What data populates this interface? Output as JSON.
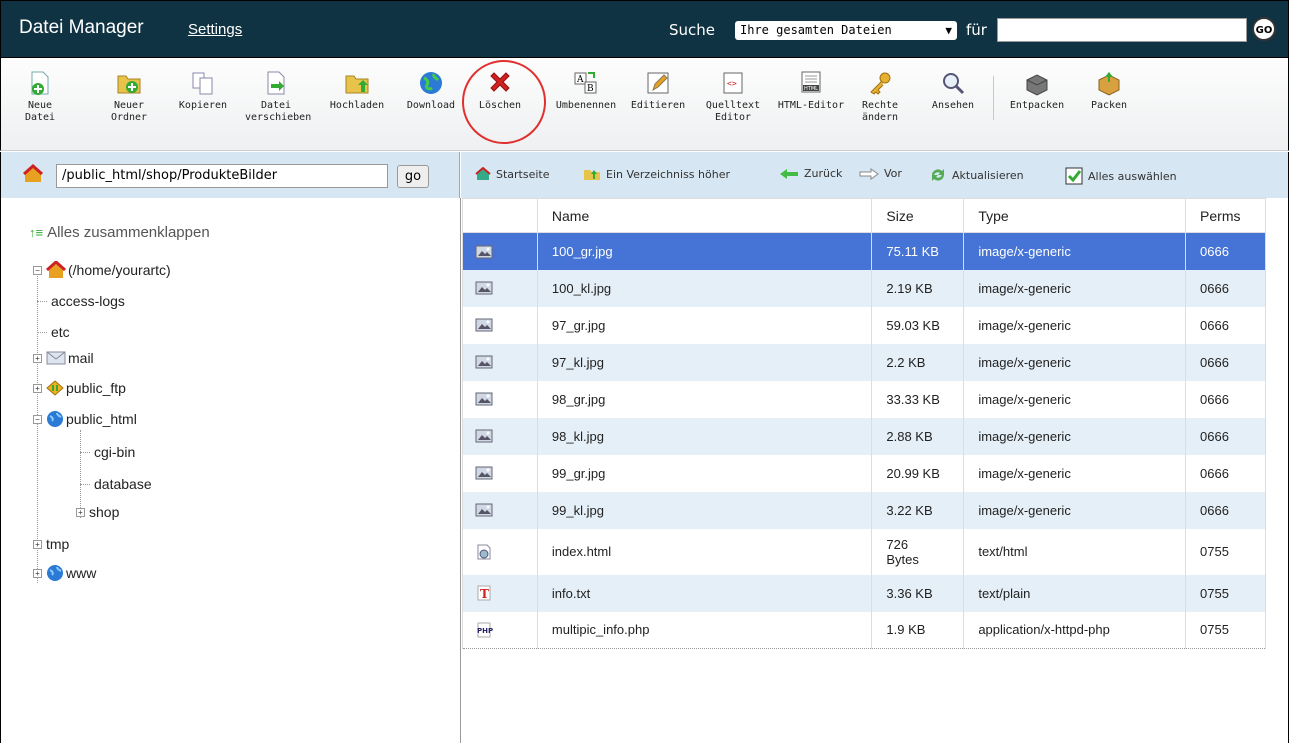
{
  "header": {
    "title": "Datei Manager",
    "settings_link": "Settings",
    "search_label": "Suche",
    "search_scope": "Ihre gesamten Dateien",
    "for_label": "für",
    "go_label": "GO"
  },
  "toolbar": {
    "new_file": "Neue Datei",
    "new_folder": "Neuer Ordner",
    "copy": "Kopieren",
    "move": "Datei verschieben",
    "upload": "Hochladen",
    "download": "Download",
    "delete": "Löschen",
    "rename": "Umbenennen",
    "edit": "Editieren",
    "source_editor": "Quelltext Editor",
    "html_editor": "HTML-Editor",
    "permissions": "Rechte ändern",
    "view": "Ansehen",
    "extract": "Entpacken",
    "compress": "Packen"
  },
  "pathbar": {
    "path": "/public_html/shop/ProdukteBilder",
    "go": "go"
  },
  "nav": {
    "home": "Startseite",
    "up": "Ein Verzeichniss höher",
    "back": "Zurück",
    "forward": "Vor",
    "refresh": "Aktualisieren",
    "select_all": "Alles auswählen"
  },
  "tree": {
    "collapse_all": "Alles zusammenklappen",
    "root": "(/home/yourartc)",
    "items": [
      "access-logs",
      "etc",
      "mail",
      "public_ftp",
      "public_html",
      "cgi-bin",
      "database",
      "shop",
      "tmp",
      "www"
    ]
  },
  "files": {
    "columns": [
      "Name",
      "Size",
      "Type",
      "Perms"
    ],
    "rows": [
      {
        "name": "100_gr.jpg",
        "size": "75.11 KB",
        "type": "image/x-generic",
        "perms": "0666",
        "icon": "image-icon"
      },
      {
        "name": "100_kl.jpg",
        "size": "2.19 KB",
        "type": "image/x-generic",
        "perms": "0666",
        "icon": "image-icon"
      },
      {
        "name": "97_gr.jpg",
        "size": "59.03 KB",
        "type": "image/x-generic",
        "perms": "0666",
        "icon": "image-icon"
      },
      {
        "name": "97_kl.jpg",
        "size": "2.2 KB",
        "type": "image/x-generic",
        "perms": "0666",
        "icon": "image-icon"
      },
      {
        "name": "98_gr.jpg",
        "size": "33.33 KB",
        "type": "image/x-generic",
        "perms": "0666",
        "icon": "image-icon"
      },
      {
        "name": "98_kl.jpg",
        "size": "2.88 KB",
        "type": "image/x-generic",
        "perms": "0666",
        "icon": "image-icon"
      },
      {
        "name": "99_gr.jpg",
        "size": "20.99 KB",
        "type": "image/x-generic",
        "perms": "0666",
        "icon": "image-icon"
      },
      {
        "name": "99_kl.jpg",
        "size": "3.22 KB",
        "type": "image/x-generic",
        "perms": "0666",
        "icon": "image-icon"
      },
      {
        "name": "index.html",
        "size": "726 Bytes",
        "type": "text/html",
        "perms": "0755",
        "icon": "html-file-icon"
      },
      {
        "name": "info.txt",
        "size": "3.36 KB",
        "type": "text/plain",
        "perms": "0755",
        "icon": "text-file-icon"
      },
      {
        "name": "multipic_info.php",
        "size": "1.9 KB",
        "type": "application/x-httpd-php",
        "perms": "0755",
        "icon": "php-file-icon"
      }
    ]
  },
  "colors": {
    "header_bg": "#0f3342",
    "selected_row": "#4573d6",
    "alt_row": "#e5eff7",
    "bar_bg": "#d6e6f2",
    "highlight_circle": "#e03030"
  }
}
